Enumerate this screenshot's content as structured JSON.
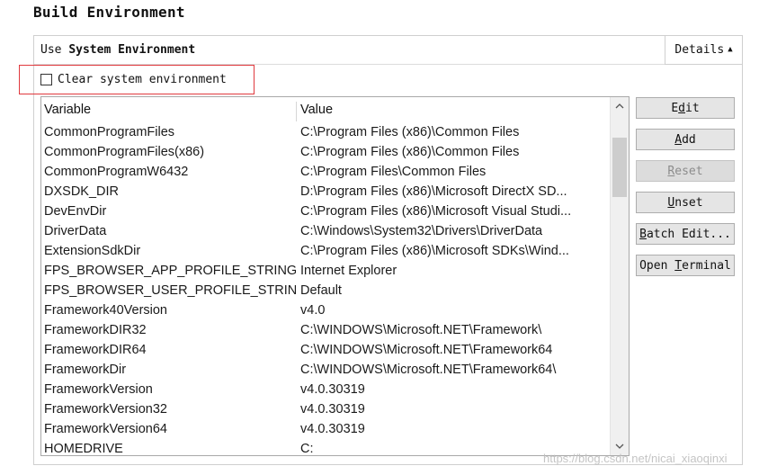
{
  "section_title": "Build Environment",
  "env_header": {
    "prefix": "Use ",
    "bold": "System Environment",
    "details_label": "Details"
  },
  "clear_system_env": {
    "label": "Clear system environment",
    "checked": false
  },
  "table": {
    "columns": [
      "Variable",
      "Value"
    ],
    "rows": [
      {
        "name": "CommonProgramFiles",
        "value": "C:\\Program Files (x86)\\Common Files"
      },
      {
        "name": "CommonProgramFiles(x86)",
        "value": "C:\\Program Files (x86)\\Common Files"
      },
      {
        "name": "CommonProgramW6432",
        "value": "C:\\Program Files\\Common Files"
      },
      {
        "name": "DXSDK_DIR",
        "value": "D:\\Program Files (x86)\\Microsoft DirectX SD..."
      },
      {
        "name": "DevEnvDir",
        "value": "C:\\Program Files (x86)\\Microsoft Visual Studi..."
      },
      {
        "name": "DriverData",
        "value": "C:\\Windows\\System32\\Drivers\\DriverData"
      },
      {
        "name": "ExtensionSdkDir",
        "value": "C:\\Program Files (x86)\\Microsoft SDKs\\Wind..."
      },
      {
        "name": "FPS_BROWSER_APP_PROFILE_STRING",
        "value": "Internet Explorer"
      },
      {
        "name": "FPS_BROWSER_USER_PROFILE_STRING",
        "value": "Default"
      },
      {
        "name": "Framework40Version",
        "value": "v4.0"
      },
      {
        "name": "FrameworkDIR32",
        "value": "C:\\WINDOWS\\Microsoft.NET\\Framework\\"
      },
      {
        "name": "FrameworkDIR64",
        "value": "C:\\WINDOWS\\Microsoft.NET\\Framework64"
      },
      {
        "name": "FrameworkDir",
        "value": "C:\\WINDOWS\\Microsoft.NET\\Framework64\\"
      },
      {
        "name": "FrameworkVersion",
        "value": "v4.0.30319"
      },
      {
        "name": "FrameworkVersion32",
        "value": "v4.0.30319"
      },
      {
        "name": "FrameworkVersion64",
        "value": "v4.0.30319"
      },
      {
        "name": "HOMEDRIVE",
        "value": "C:"
      }
    ]
  },
  "buttons": [
    {
      "key": "edit",
      "pre": "E",
      "mn": "d",
      "post": "it",
      "enabled": true
    },
    {
      "key": "add",
      "pre": "",
      "mn": "A",
      "post": "dd",
      "enabled": true
    },
    {
      "key": "reset",
      "pre": "",
      "mn": "R",
      "post": "eset",
      "enabled": false
    },
    {
      "key": "unset",
      "pre": "",
      "mn": "U",
      "post": "nset",
      "enabled": true
    },
    {
      "key": "batch-edit",
      "pre": "",
      "mn": "B",
      "post": "atch Edit...",
      "enabled": true
    },
    {
      "key": "open-terminal",
      "pre": "Open ",
      "mn": "T",
      "post": "erminal",
      "enabled": true
    }
  ],
  "watermark": "https://blog.csdn.net/nicai_xiaoqinxi",
  "colors": {
    "highlight_border": "#e0393e",
    "button_bg": "#e5e5e5",
    "disabled_text": "#8c8c8c"
  }
}
